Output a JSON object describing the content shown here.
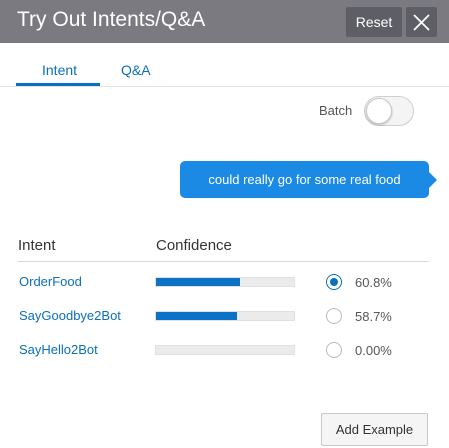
{
  "header": {
    "title": "Try Out Intents/Q&A",
    "reset_label": "Reset",
    "close_icon": "close-icon"
  },
  "tabs": [
    {
      "label": "Intent",
      "active": true
    },
    {
      "label": "Q&A",
      "active": false
    }
  ],
  "batch": {
    "label": "Batch",
    "enabled": false
  },
  "message": {
    "text": "could really go for some real food"
  },
  "results": {
    "columns": {
      "intent": "Intent",
      "confidence": "Confidence"
    },
    "rows": [
      {
        "intent": "OrderFood",
        "confidence": 0.608,
        "confidence_label": "60.8%",
        "selected": true
      },
      {
        "intent": "SayGoodbye2Bot",
        "confidence": 0.587,
        "confidence_label": "58.7%",
        "selected": false
      },
      {
        "intent": "SayHello2Bot",
        "confidence": 0.0,
        "confidence_label": "0.00%",
        "selected": false
      }
    ]
  },
  "footer": {
    "add_example_label": "Add Example"
  },
  "colors": {
    "header_bg": "#7a7a80",
    "accent": "#0a6fbc",
    "bubble": "#1a8ae5",
    "bar_fill": "#0c72c6"
  }
}
